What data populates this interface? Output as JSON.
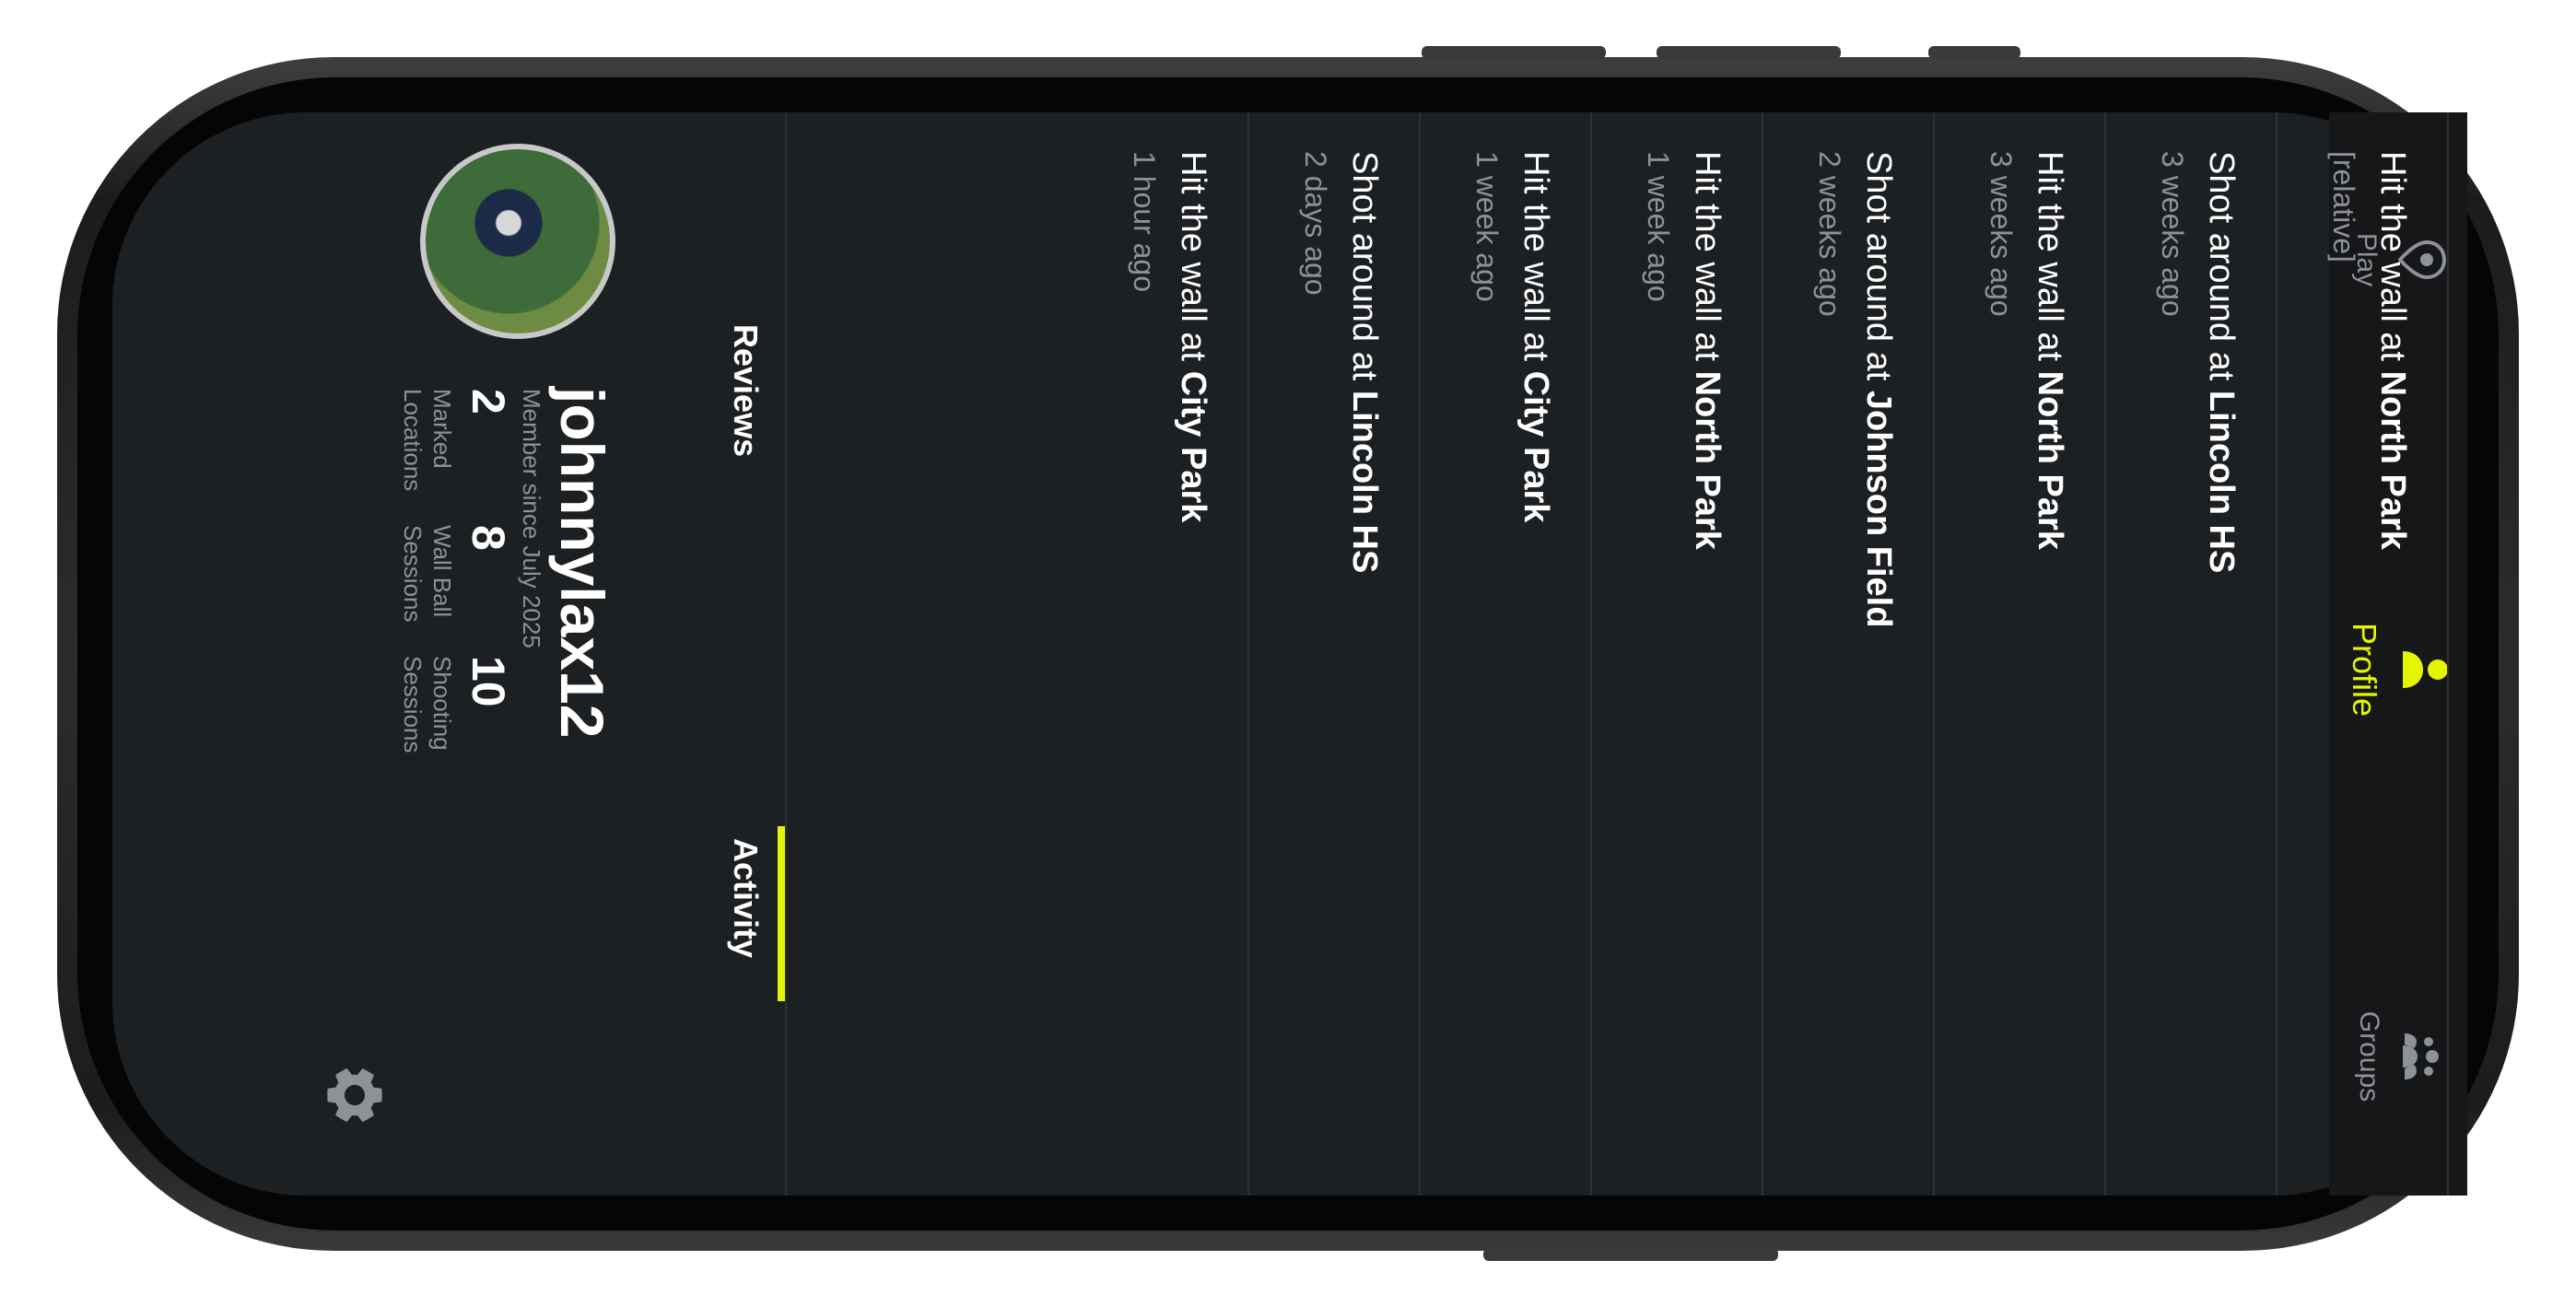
{
  "profile": {
    "username": "johnnylax12",
    "member_since": "Member since July 2025",
    "stats": [
      {
        "value": "2",
        "label_line1": "Marked",
        "label_line2": "Locations"
      },
      {
        "value": "8",
        "label_line1": "Wall Ball",
        "label_line2": "Sessions"
      },
      {
        "value": "10",
        "label_line1": "Shooting",
        "label_line2": "Sessions"
      }
    ],
    "settings_icon": "gear-icon",
    "avatar_icon": "lacrosse-player-photo"
  },
  "profile_tabs": {
    "activity": "Activity",
    "reviews": "Reviews",
    "active": "Activity"
  },
  "feed": [
    {
      "prefix": "Hit the wall at ",
      "place": "City Park",
      "time": "1 hour ago"
    },
    {
      "prefix": "Shot around at ",
      "place": "Lincoln HS",
      "time": "2 days ago"
    },
    {
      "prefix": "Hit the wall at ",
      "place": "City Park",
      "time": "1 week ago"
    },
    {
      "prefix": "Hit the wall at ",
      "place": "North Park",
      "time": "1 week ago"
    },
    {
      "prefix": "Shot around at ",
      "place": "Johnson Field",
      "time": "2 weeks ago"
    },
    {
      "prefix": "Hit the wall at ",
      "place": "North Park",
      "time": "3 weeks ago"
    },
    {
      "prefix": "Shot around at ",
      "place": "Lincoln HS",
      "time": "3 weeks ago"
    },
    {
      "prefix": "Hit the wall at ",
      "place": "North Park",
      "time": "[relative]"
    }
  ],
  "tabbar": {
    "items": [
      {
        "label": "Play",
        "icon": "location-pin-icon"
      },
      {
        "label": "Profile",
        "icon": "person-icon"
      },
      {
        "label": "Groups",
        "icon": "group-icon"
      }
    ],
    "active": "Profile"
  },
  "colors": {
    "accent": "#e4f500",
    "background": "#1d2023",
    "tabbar": "#151718",
    "muted_text": "#8e9197"
  }
}
